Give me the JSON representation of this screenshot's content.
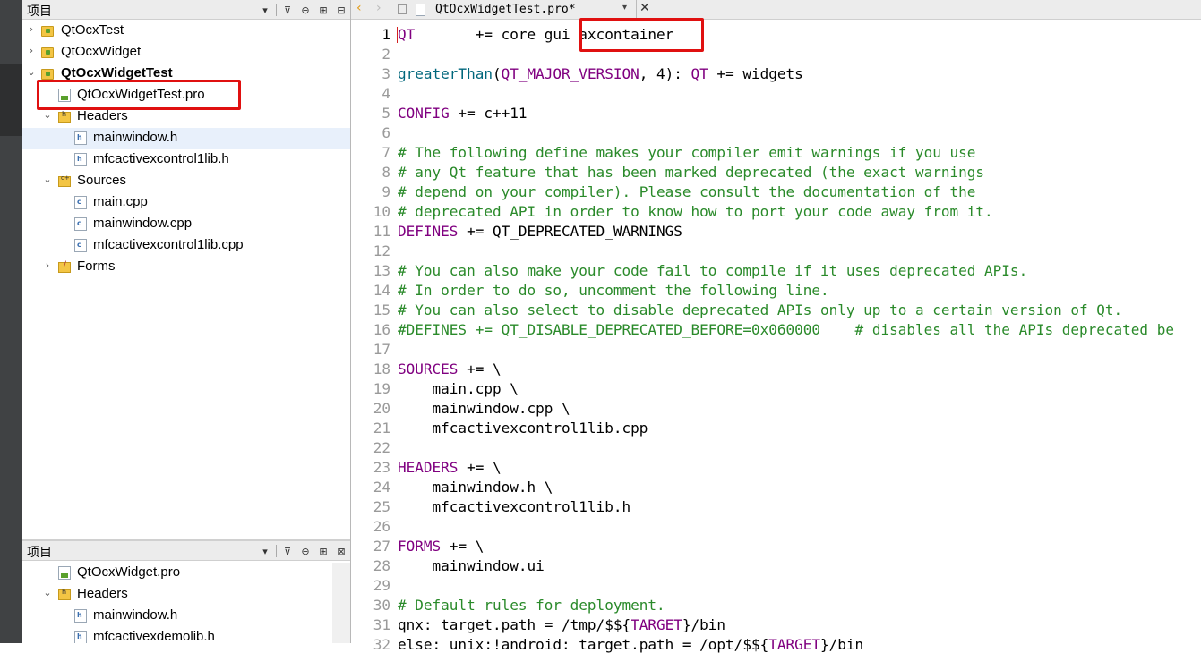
{
  "project_panel_top": {
    "title": "项目",
    "items": [
      {
        "label": "QtOcxTest",
        "expanded": false
      },
      {
        "label": "QtOcxWidget",
        "expanded": false
      },
      {
        "label": "QtOcxWidgetTest",
        "expanded": true,
        "bold": true
      },
      {
        "label": "QtOcxWidgetTest.pro",
        "highlighted": true
      },
      {
        "label": "Headers",
        "expanded": true
      },
      {
        "label": "mainwindow.h",
        "selected": true
      },
      {
        "label": "mfcactivexcontrol1lib.h"
      },
      {
        "label": "Sources",
        "expanded": true
      },
      {
        "label": "main.cpp"
      },
      {
        "label": "mainwindow.cpp"
      },
      {
        "label": "mfcactivexcontrol1lib.cpp"
      },
      {
        "label": "Forms",
        "expanded": false
      }
    ]
  },
  "project_panel_bottom": {
    "title": "项目",
    "items": [
      {
        "label": "QtOcxWidget.pro"
      },
      {
        "label": "Headers",
        "expanded": true
      },
      {
        "label": "mainwindow.h"
      },
      {
        "label": "mfcactivexdemolib.h"
      }
    ]
  },
  "editor": {
    "filename": "QtOcxWidgetTest.pro*",
    "current_line": 1,
    "line_numbers": [
      "1",
      "2",
      "3",
      "4",
      "5",
      "6",
      "7",
      "8",
      "9",
      "10",
      "11",
      "12",
      "13",
      "14",
      "15",
      "16",
      "17",
      "18",
      "19",
      "20",
      "21",
      "22",
      "23",
      "24",
      "25",
      "26",
      "27",
      "28",
      "29",
      "30",
      "31",
      "32"
    ],
    "lines": {
      "l1_qt": "QT",
      "l1_rest": "       += core gui ",
      "l1_ax": "axcontainer",
      "l3_fn": "greaterThan",
      "l3_paren": "(",
      "l3_var": "QT_MAJOR_VERSION",
      "l3_mid": ", 4): ",
      "l3_qt": "QT",
      "l3_rest": " += widgets",
      "l5_kw": "CONFIG",
      "l5_rest": " += c++11",
      "l7": "# The following define makes your compiler emit warnings if you use",
      "l8": "# any Qt feature that has been marked deprecated (the exact warnings",
      "l9": "# depend on your compiler). Please consult the documentation of the",
      "l10": "# deprecated API in order to know how to port your code away from it.",
      "l11_kw": "DEFINES",
      "l11_rest": " += QT_DEPRECATED_WARNINGS",
      "l13": "# You can also make your code fail to compile if it uses deprecated APIs.",
      "l14": "# In order to do so, uncomment the following line.",
      "l15": "# You can also select to disable deprecated APIs only up to a certain version of Qt.",
      "l16_cm1": "#DEFINES += QT_DISABLE_DEPRECATED_BEFORE=0x060000",
      "l16_cm2": "    # disables all the APIs deprecated be",
      "l18_kw": "SOURCES",
      "l18_rest": " += \\",
      "l19": "    main.cpp \\",
      "l20": "    mainwindow.cpp \\",
      "l21": "    mfcactivexcontrol1lib.cpp",
      "l23_kw": "HEADERS",
      "l23_rest": " += \\",
      "l24": "    mainwindow.h \\",
      "l25": "    mfcactivexcontrol1lib.h",
      "l27_kw": "FORMS",
      "l27_rest": " += \\",
      "l28": "    mainwindow.ui",
      "l30": "# Default rules for deployment.",
      "l31_a": "qnx: target.path = /tmp/$${",
      "l31_kw": "TARGET",
      "l31_b": "}/bin",
      "l32_a": "else: unix:!android: target.path = /opt/$${",
      "l32_kw": "TARGET",
      "l32_b": "}/bin"
    }
  },
  "icons": {
    "filter": "filter-icon",
    "link": "link-icon",
    "split": "split-icon",
    "close_pane": "close-pane-icon"
  },
  "colors": {
    "highlight_box": "#e01010",
    "keyword": "#800080",
    "comment": "#2a8a2a"
  }
}
